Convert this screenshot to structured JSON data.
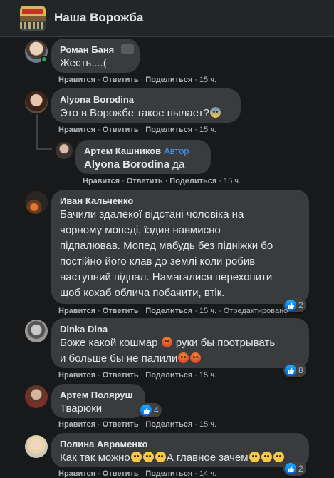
{
  "group": {
    "title": "Наша Ворожба"
  },
  "actions": {
    "like": "Нравится",
    "reply": "Ответить",
    "share": "Поделиться",
    "dot": "·"
  },
  "comments": [
    {
      "author": "Роман Баня",
      "text": "Жесть....(",
      "time": "15 ч."
    },
    {
      "author": "Alyona Borodina",
      "text": "Это в Ворожбе такое пылает?",
      "time": "15 ч."
    },
    {
      "author": "Артем Кашников",
      "badge": "Автор",
      "mention": "Alyona Borodina",
      "text": " да",
      "time": "15 ч."
    },
    {
      "author": "Иван Кальченко",
      "lines": [
        "Бачили здалекої відстані чоловіка на",
        "чорному мопеді, їздив навмисно",
        "підпалював. Мопед мабудь без підніжки бо",
        "постійно його клав до землі коли робив",
        "наступний підпал. Намагалися перехопити",
        "щоб кохаб облича побачити, втік."
      ],
      "time": "15 ч.",
      "edited": "Отредактировано",
      "reactions": "2"
    },
    {
      "author": "Dinka Dina",
      "line1a": "Боже какой кошмар",
      "line1b": "руки бы поотрывать",
      "line2": "и больше бы не палили",
      "time": "15 ч.",
      "reactions": "8"
    },
    {
      "author": "Артем Поляруш",
      "text": "Тварюки",
      "time": "15 ч.",
      "reactions": "4"
    },
    {
      "author": "Полина Авраменко",
      "texta": "Как так можно",
      "textb": "А главное зачем",
      "time": "14 ч.",
      "reactions": "2"
    }
  ],
  "colors": {
    "background": "#18191a",
    "bubble": "#3a3b3c",
    "link": "#4599ff",
    "meta": "#b0b3b8",
    "like": "#1877f2"
  },
  "icons": [
    "like-icon",
    "messenger-icon",
    "angry-emoji",
    "sad-emoji",
    "scream-emoji"
  ]
}
